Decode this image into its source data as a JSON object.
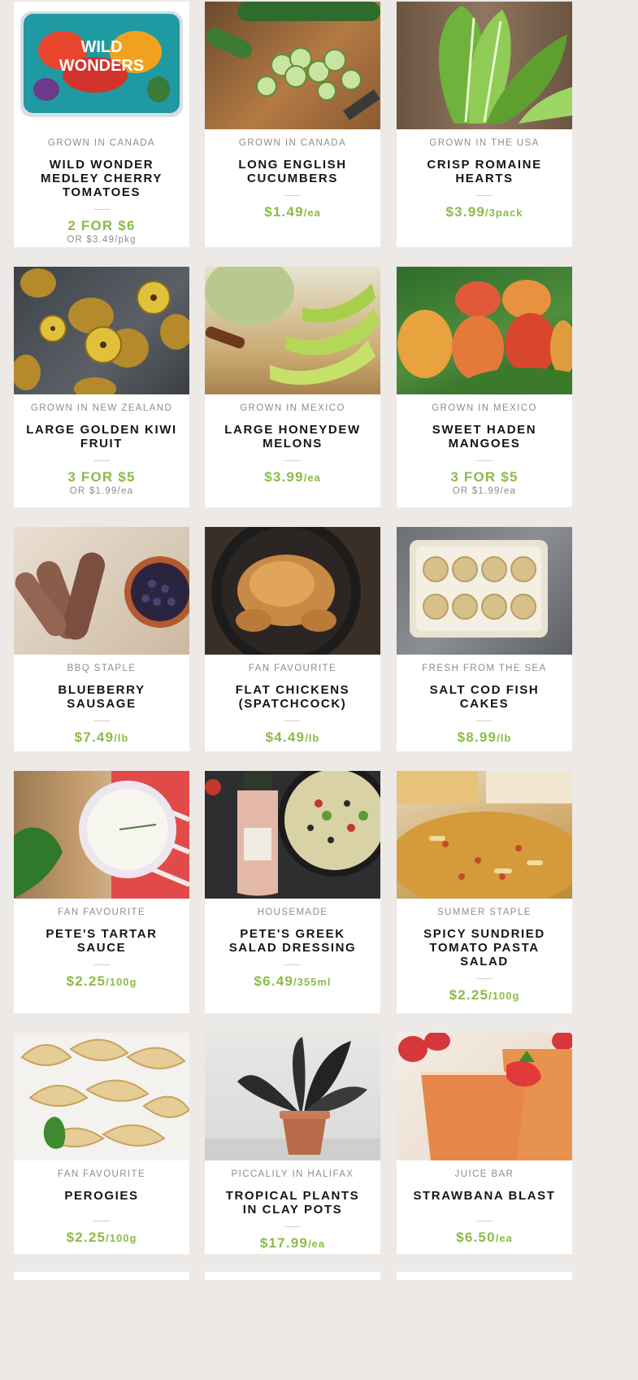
{
  "products": [
    {
      "origin": "GROWN IN CANADA",
      "name": "WILD WONDER MEDLEY CHERRY TOMATOES",
      "price": "2 FOR $6",
      "unit": "",
      "alt": "OR $3.49/pkg",
      "image": "wild-wonders-tomato-package"
    },
    {
      "origin": "GROWN IN CANADA",
      "name": "LONG ENGLISH CUCUMBERS",
      "price": "$1.49",
      "unit": "/ea",
      "alt": "",
      "image": "sliced-cucumbers"
    },
    {
      "origin": "GROWN IN THE USA",
      "name": "CRISP ROMAINE HEARTS",
      "price": "$3.99",
      "unit": "/3pack",
      "alt": "",
      "image": "romaine-hearts"
    },
    {
      "origin": "GROWN IN NEW ZEALAND",
      "name": "LARGE GOLDEN KIWI FRUIT",
      "price": "3 FOR $5",
      "unit": "",
      "alt": "OR $1.99/ea",
      "image": "golden-kiwi"
    },
    {
      "origin": "GROWN IN MEXICO",
      "name": "LARGE HONEYDEW MELONS",
      "price": "$3.99",
      "unit": "/ea",
      "alt": "",
      "image": "honeydew-slices"
    },
    {
      "origin": "GROWN IN MEXICO",
      "name": "SWEET HADEN MANGOES",
      "price": "3 FOR $5",
      "unit": "",
      "alt": "OR $1.99/ea",
      "image": "haden-mangoes"
    },
    {
      "origin": "BBQ STAPLE",
      "name": "BLUEBERRY SAUSAGE",
      "price": "$7.49",
      "unit": "/lb",
      "alt": "",
      "image": "blueberry-sausage"
    },
    {
      "origin": "FAN FAVOURITE",
      "name": "FLAT CHICKENS (SPATCHCOCK)",
      "price": "$4.49",
      "unit": "/lb",
      "alt": "",
      "image": "roast-chicken-skillet"
    },
    {
      "origin": "FRESH FROM THE SEA",
      "name": "SALT COD FISH CAKES",
      "price": "$8.99",
      "unit": "/lb",
      "alt": "",
      "image": "fish-cakes-tray"
    },
    {
      "origin": "FAN FAVOURITE",
      "name": "PETE'S TARTAR SAUCE",
      "price": "$2.25",
      "unit": "/100g",
      "alt": "",
      "image": "tartar-sauce-bowl"
    },
    {
      "origin": "HOUSEMADE",
      "name": "PETE'S GREEK SALAD DRESSING",
      "price": "$6.49",
      "unit": "/355ml",
      "alt": "",
      "image": "greek-dressing-bottle"
    },
    {
      "origin": "SUMMER STAPLE",
      "name": "SPICY SUNDRIED TOMATO PASTA SALAD",
      "price": "$2.25",
      "unit": "/100g",
      "alt": "",
      "image": "pasta-salad-counter"
    },
    {
      "origin": "FAN FAVOURITE",
      "name": "PEROGIES",
      "price": "$2.25",
      "unit": "/100g",
      "alt": "",
      "image": "perogies-plate"
    },
    {
      "origin": "PICCALILY IN HALIFAX",
      "name": "TROPICAL PLANTS IN CLAY POTS",
      "price": "$17.99",
      "unit": "/ea",
      "alt": "",
      "image": "potted-tropical-plant"
    },
    {
      "origin": "JUICE BAR",
      "name": "STRAWBANA BLAST",
      "price": "$6.50",
      "unit": "/ea",
      "alt": "",
      "image": "strawberry-smoothie"
    }
  ],
  "colors": {
    "background": "#ece9e6",
    "card": "#ffffff",
    "price": "#8bbb4a",
    "label": "#8d8d8d",
    "title": "#151515"
  }
}
